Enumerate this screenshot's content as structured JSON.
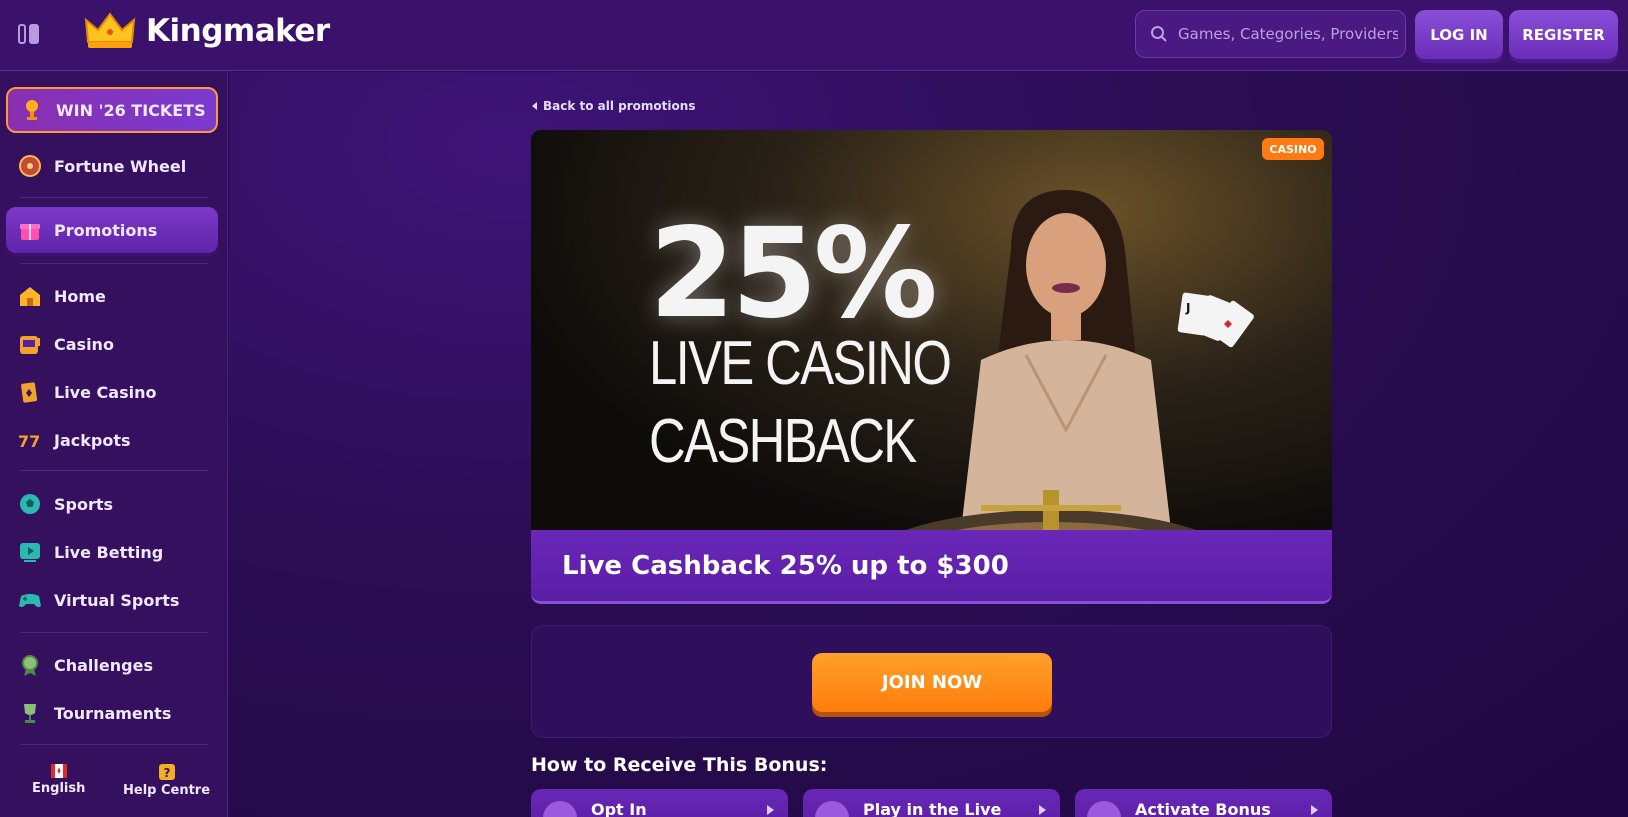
{
  "header": {
    "brand": "Kingmaker",
    "search_placeholder": "Games, Categories, Providers",
    "login_label": "LOG IN",
    "register_label": "REGISTER"
  },
  "sidebar": {
    "items": [
      {
        "label": "WIN '26 TICKETS",
        "icon": "trophy-icon"
      },
      {
        "label": "Fortune Wheel",
        "icon": "fortune-wheel-icon"
      },
      {
        "label": "Promotions",
        "icon": "gift-icon"
      },
      {
        "label": "Home",
        "icon": "home-icon"
      },
      {
        "label": "Casino",
        "icon": "slot-machine-icon"
      },
      {
        "label": "Live Casino",
        "icon": "playing-card-icon"
      },
      {
        "label": "Jackpots",
        "icon": "sevens-icon"
      },
      {
        "label": "Sports",
        "icon": "soccer-ball-icon"
      },
      {
        "label": "Live Betting",
        "icon": "play-screen-icon"
      },
      {
        "label": "Virtual Sports",
        "icon": "gamepad-icon"
      },
      {
        "label": "Challenges",
        "icon": "medal-icon"
      },
      {
        "label": "Tournaments",
        "icon": "cup-icon"
      }
    ],
    "footer": {
      "language": "English",
      "help": "Help Centre"
    }
  },
  "main": {
    "back_label": "Back to all promotions",
    "badge": "CASINO",
    "hero_percent": "25%",
    "hero_line1": "LIVE CASINO",
    "hero_line2": "CASHBACK",
    "promo_title": "Live Cashback 25% up to $300",
    "join_label": "JOIN NOW",
    "howto_title": "How to Receive This Bonus:",
    "steps": [
      {
        "label": "Opt In"
      },
      {
        "label": "Play in the Live"
      },
      {
        "label": "Activate Bonus"
      }
    ]
  },
  "colors": {
    "accent_purple": "#6a27b8",
    "accent_orange": "#ff7d0d",
    "background": "#2a0d52"
  }
}
